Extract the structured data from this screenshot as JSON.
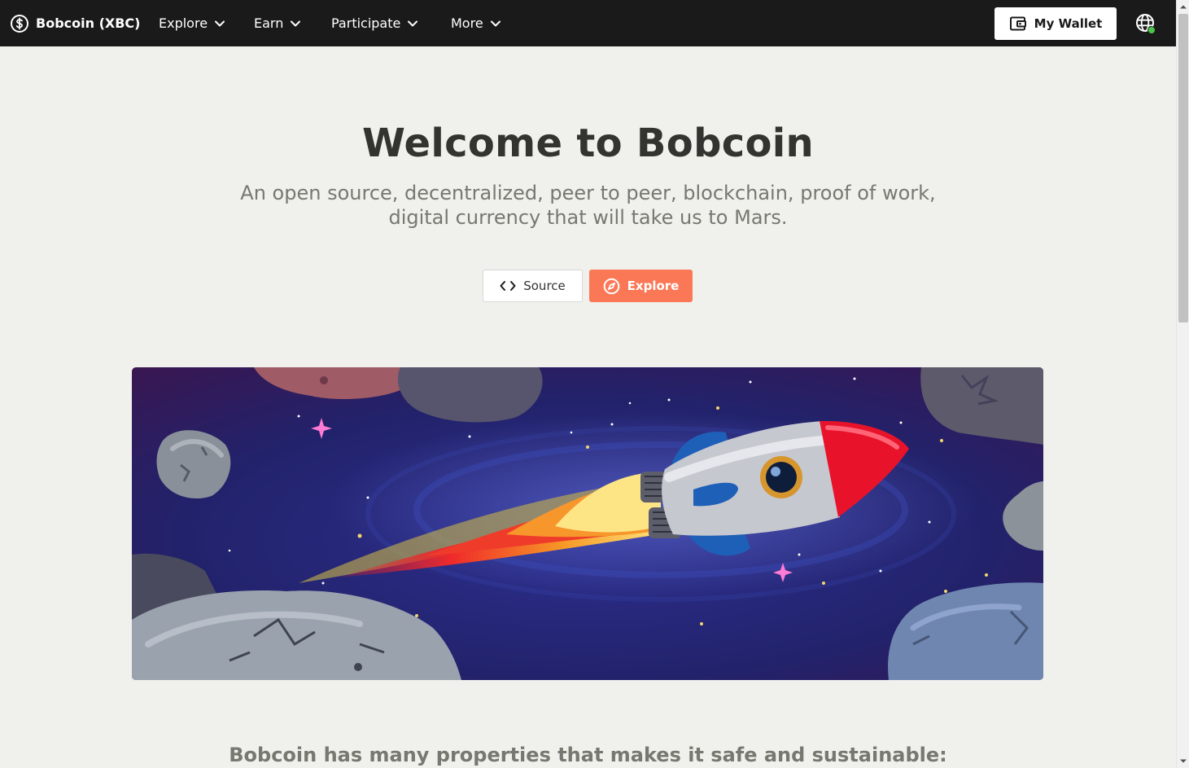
{
  "navbar": {
    "brand": "Bobcoin (XBC)",
    "brand_icon": "dollar-coin-icon",
    "items": [
      {
        "label": "Explore"
      },
      {
        "label": "Earn"
      },
      {
        "label": "Participate"
      },
      {
        "label": "More"
      }
    ],
    "wallet_label": "My Wallet",
    "wallet_icon": "wallet-icon",
    "language_icon": "globe-icon",
    "status_color": "#4cc54c"
  },
  "hero": {
    "title": "Welcome to Bobcoin",
    "subtitle": "An open source, decentralized, peer to peer, blockchain, proof of work, digital currency that will take us to Mars.",
    "source_label": "Source",
    "explore_label": "Explore",
    "accent_color": "#fb7857"
  },
  "banner": {
    "icon": "rocket-in-space-illustration"
  },
  "properties": {
    "heading": "Bobcoin has many properties that makes it safe and sustainable:"
  }
}
